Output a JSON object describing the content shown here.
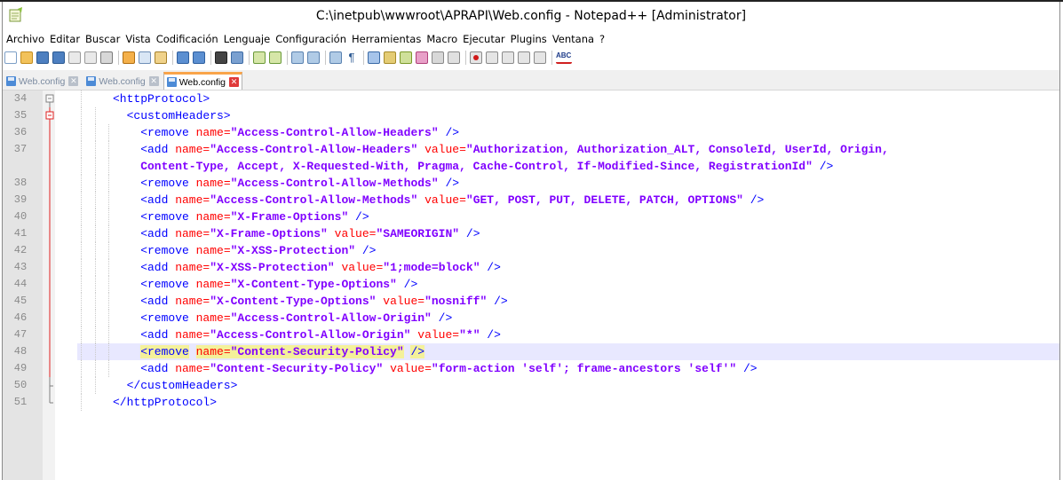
{
  "window": {
    "title": "C:\\inetpub\\wwwroot\\APRAPI\\Web.config - Notepad++ [Administrator]"
  },
  "menu": [
    "Archivo",
    "Editar",
    "Buscar",
    "Vista",
    "Codificación",
    "Lenguaje",
    "Configuración",
    "Herramientas",
    "Macro",
    "Ejecutar",
    "Plugins",
    "Ventana",
    "?"
  ],
  "tabs": [
    {
      "label": "Web.config",
      "active": false
    },
    {
      "label": "Web.config",
      "active": false
    },
    {
      "label": "Web.config",
      "active": true
    }
  ],
  "colors": {
    "tag": "#0000ff",
    "attribute": "#ff0000",
    "value": "#8000ff",
    "current_line": "#e8e8ff",
    "active_tab_accent": "#f9a44a"
  },
  "lines": [
    {
      "n": "34",
      "fold": "open-top",
      "indent": 2,
      "tokens": [
        [
          "tag",
          "<httpProtocol>"
        ]
      ]
    },
    {
      "n": "35",
      "fold": "open-red",
      "indent": 3,
      "tokens": [
        [
          "tag",
          "<customHeaders>"
        ]
      ]
    },
    {
      "n": "36",
      "fold": "line",
      "indent": 4,
      "tokens": [
        [
          "tag",
          "<remove "
        ],
        [
          "attr",
          "name="
        ],
        [
          "val",
          "\"Access-Control-Allow-Headers\""
        ],
        [
          "tag",
          " />"
        ]
      ]
    },
    {
      "n": "37",
      "fold": "line",
      "indent": 4,
      "tokens": [
        [
          "tag",
          "<add "
        ],
        [
          "attr",
          "name="
        ],
        [
          "val",
          "\"Access-Control-Allow-Headers\""
        ],
        [
          "tag",
          " "
        ],
        [
          "attr",
          "value="
        ],
        [
          "val",
          "\"Authorization, Authorization_ALT, ConsoleId, UserId, Origin,"
        ]
      ]
    },
    {
      "n": "",
      "fold": "line",
      "indent": 4,
      "tokens": [
        [
          "val",
          "Content-Type, Accept, X-Requested-With, Pragma, Cache-Control, If-Modified-Since, RegistrationId\""
        ],
        [
          "tag",
          " />"
        ]
      ]
    },
    {
      "n": "38",
      "fold": "line",
      "indent": 4,
      "tokens": [
        [
          "tag",
          "<remove "
        ],
        [
          "attr",
          "name="
        ],
        [
          "val",
          "\"Access-Control-Allow-Methods\""
        ],
        [
          "tag",
          " />"
        ]
      ]
    },
    {
      "n": "39",
      "fold": "line",
      "indent": 4,
      "tokens": [
        [
          "tag",
          "<add "
        ],
        [
          "attr",
          "name="
        ],
        [
          "val",
          "\"Access-Control-Allow-Methods\""
        ],
        [
          "tag",
          " "
        ],
        [
          "attr",
          "value="
        ],
        [
          "val",
          "\"GET, POST, PUT, DELETE, PATCH, OPTIONS\""
        ],
        [
          "tag",
          " />"
        ]
      ]
    },
    {
      "n": "40",
      "fold": "line",
      "indent": 4,
      "tokens": [
        [
          "tag",
          "<remove "
        ],
        [
          "attr",
          "name="
        ],
        [
          "val",
          "\"X-Frame-Options\""
        ],
        [
          "tag",
          " />"
        ]
      ]
    },
    {
      "n": "41",
      "fold": "line",
      "indent": 4,
      "tokens": [
        [
          "tag",
          "<add "
        ],
        [
          "attr",
          "name="
        ],
        [
          "val",
          "\"X-Frame-Options\""
        ],
        [
          "tag",
          " "
        ],
        [
          "attr",
          "value="
        ],
        [
          "val",
          "\"SAMEORIGIN\""
        ],
        [
          "tag",
          " />"
        ]
      ]
    },
    {
      "n": "42",
      "fold": "line",
      "indent": 4,
      "tokens": [
        [
          "tag",
          "<remove "
        ],
        [
          "attr",
          "name="
        ],
        [
          "val",
          "\"X-XSS-Protection\""
        ],
        [
          "tag",
          " />"
        ]
      ]
    },
    {
      "n": "43",
      "fold": "line",
      "indent": 4,
      "tokens": [
        [
          "tag",
          "<add "
        ],
        [
          "attr",
          "name="
        ],
        [
          "val",
          "\"X-XSS-Protection\""
        ],
        [
          "tag",
          " "
        ],
        [
          "attr",
          "value="
        ],
        [
          "val",
          "\"1;mode=block\""
        ],
        [
          "tag",
          " />"
        ]
      ]
    },
    {
      "n": "44",
      "fold": "line",
      "indent": 4,
      "tokens": [
        [
          "tag",
          "<remove "
        ],
        [
          "attr",
          "name="
        ],
        [
          "val",
          "\"X-Content-Type-Options\""
        ],
        [
          "tag",
          " />"
        ]
      ]
    },
    {
      "n": "45",
      "fold": "line",
      "indent": 4,
      "tokens": [
        [
          "tag",
          "<add "
        ],
        [
          "attr",
          "name="
        ],
        [
          "val",
          "\"X-Content-Type-Options\""
        ],
        [
          "tag",
          " "
        ],
        [
          "attr",
          "value="
        ],
        [
          "val",
          "\"nosniff\""
        ],
        [
          "tag",
          " />"
        ]
      ]
    },
    {
      "n": "46",
      "fold": "line",
      "indent": 4,
      "tokens": [
        [
          "tag",
          "<remove "
        ],
        [
          "attr",
          "name="
        ],
        [
          "val",
          "\"Access-Control-Allow-Origin\""
        ],
        [
          "tag",
          " />"
        ]
      ]
    },
    {
      "n": "47",
      "fold": "line",
      "indent": 4,
      "tokens": [
        [
          "tag",
          "<add "
        ],
        [
          "attr",
          "name="
        ],
        [
          "val",
          "\"Access-Control-Allow-Origin\""
        ],
        [
          "tag",
          " "
        ],
        [
          "attr",
          "value="
        ],
        [
          "val",
          "\"*\""
        ],
        [
          "tag",
          " />"
        ]
      ]
    },
    {
      "n": "48",
      "fold": "line",
      "indent": 4,
      "current": true,
      "tokens": [
        [
          "tag mark",
          "<remove"
        ],
        [
          "tag",
          " "
        ],
        [
          "attr mark",
          "name="
        ],
        [
          "val mark",
          "\"Content-Security-Policy\""
        ],
        [
          "tag",
          " "
        ],
        [
          "tag mark",
          "/>"
        ]
      ]
    },
    {
      "n": "49",
      "fold": "line",
      "indent": 4,
      "tokens": [
        [
          "tag",
          "<add "
        ],
        [
          "attr",
          "name="
        ],
        [
          "val",
          "\"Content-Security-Policy\""
        ],
        [
          "tag",
          " "
        ],
        [
          "attr",
          "value="
        ],
        [
          "val",
          "\"form-action 'self'; frame-ancestors 'self'\""
        ],
        [
          "tag",
          " />"
        ]
      ]
    },
    {
      "n": "50",
      "fold": "end",
      "indent": 3,
      "tokens": [
        [
          "tag",
          "</customHeaders>"
        ]
      ]
    },
    {
      "n": "51",
      "fold": "end",
      "indent": 2,
      "tokens": [
        [
          "tag",
          "</httpProtocol>"
        ]
      ]
    }
  ]
}
